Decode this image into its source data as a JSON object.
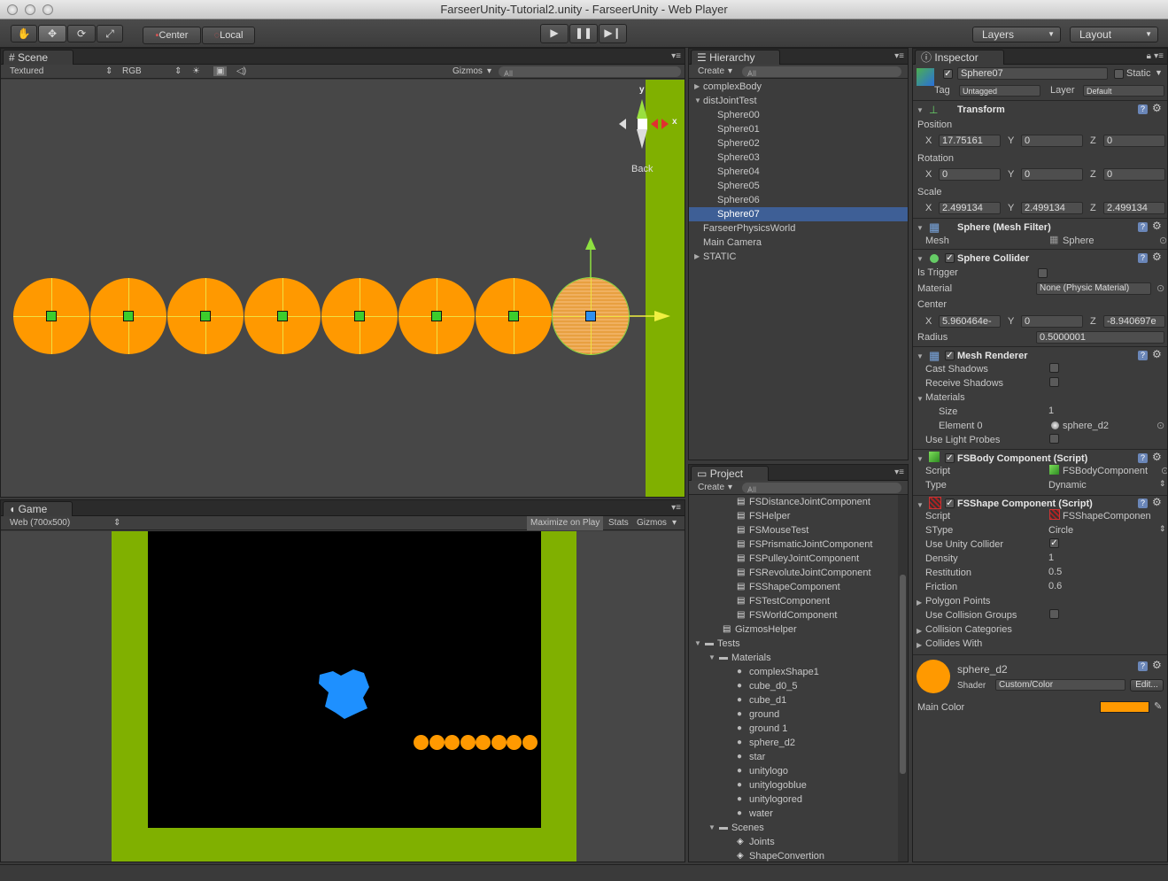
{
  "window": {
    "title": "FarseerUnity-Tutorial2.unity - FarseerUnity - Web Player"
  },
  "toolbar": {
    "pivot_center": "Center",
    "pivot_local": "Local",
    "layers": "Layers",
    "layout": "Layout"
  },
  "scene": {
    "tab": "Scene",
    "render_mode": "Textured",
    "color_mode": "RGB",
    "gizmos": "Gizmos",
    "search_placeholder": "All",
    "gizmo_view_label": "Back",
    "gizmo_axis_y": "y",
    "gizmo_axis_x": "x"
  },
  "game": {
    "tab": "Game",
    "resolution": "Web (700x500)",
    "maximize": "Maximize on Play",
    "stats": "Stats",
    "gizmos": "Gizmos"
  },
  "hierarchy": {
    "tab": "Hierarchy",
    "create": "Create",
    "search_placeholder": "All",
    "items": [
      {
        "label": "complexBody",
        "indent": 0,
        "arrow": "closed",
        "selected": false
      },
      {
        "label": "distJointTest",
        "indent": 0,
        "arrow": "open",
        "selected": false
      },
      {
        "label": "Sphere00",
        "indent": 1,
        "arrow": "",
        "selected": false
      },
      {
        "label": "Sphere01",
        "indent": 1,
        "arrow": "",
        "selected": false
      },
      {
        "label": "Sphere02",
        "indent": 1,
        "arrow": "",
        "selected": false
      },
      {
        "label": "Sphere03",
        "indent": 1,
        "arrow": "",
        "selected": false
      },
      {
        "label": "Sphere04",
        "indent": 1,
        "arrow": "",
        "selected": false
      },
      {
        "label": "Sphere05",
        "indent": 1,
        "arrow": "",
        "selected": false
      },
      {
        "label": "Sphere06",
        "indent": 1,
        "arrow": "",
        "selected": false
      },
      {
        "label": "Sphere07",
        "indent": 1,
        "arrow": "",
        "selected": true
      },
      {
        "label": "FarseerPhysicsWorld",
        "indent": 0,
        "arrow": "",
        "selected": false
      },
      {
        "label": "Main Camera",
        "indent": 0,
        "arrow": "",
        "selected": false
      },
      {
        "label": "STATIC",
        "indent": 0,
        "arrow": "closed",
        "selected": false
      }
    ]
  },
  "project": {
    "tab": "Project",
    "create": "Create",
    "search_placeholder": "All",
    "items": [
      {
        "label": "FSDistanceJointComponent",
        "indent": 3,
        "arrow": "",
        "icon": "script"
      },
      {
        "label": "FSHelper",
        "indent": 3,
        "arrow": "",
        "icon": "script"
      },
      {
        "label": "FSMouseTest",
        "indent": 3,
        "arrow": "",
        "icon": "script"
      },
      {
        "label": "FSPrismaticJointComponent",
        "indent": 3,
        "arrow": "",
        "icon": "script"
      },
      {
        "label": "FSPulleyJointComponent",
        "indent": 3,
        "arrow": "",
        "icon": "script"
      },
      {
        "label": "FSRevoluteJointComponent",
        "indent": 3,
        "arrow": "",
        "icon": "script"
      },
      {
        "label": "FSShapeComponent",
        "indent": 3,
        "arrow": "",
        "icon": "script"
      },
      {
        "label": "FSTestComponent",
        "indent": 3,
        "arrow": "",
        "icon": "script"
      },
      {
        "label": "FSWorldComponent",
        "indent": 3,
        "arrow": "",
        "icon": "script"
      },
      {
        "label": "GizmosHelper",
        "indent": 2,
        "arrow": "",
        "icon": "script"
      },
      {
        "label": "Tests",
        "indent": 0,
        "arrow": "open",
        "icon": "folder"
      },
      {
        "label": "Materials",
        "indent": 1,
        "arrow": "open",
        "icon": "folder"
      },
      {
        "label": "complexShape1",
        "indent": 3,
        "arrow": "",
        "icon": "material"
      },
      {
        "label": "cube_d0_5",
        "indent": 3,
        "arrow": "",
        "icon": "material"
      },
      {
        "label": "cube_d1",
        "indent": 3,
        "arrow": "",
        "icon": "material"
      },
      {
        "label": "ground",
        "indent": 3,
        "arrow": "",
        "icon": "material"
      },
      {
        "label": "ground 1",
        "indent": 3,
        "arrow": "",
        "icon": "material"
      },
      {
        "label": "sphere_d2",
        "indent": 3,
        "arrow": "",
        "icon": "material"
      },
      {
        "label": "star",
        "indent": 3,
        "arrow": "",
        "icon": "material"
      },
      {
        "label": "unitylogo",
        "indent": 3,
        "arrow": "",
        "icon": "material"
      },
      {
        "label": "unitylogoblue",
        "indent": 3,
        "arrow": "",
        "icon": "material"
      },
      {
        "label": "unitylogored",
        "indent": 3,
        "arrow": "",
        "icon": "material"
      },
      {
        "label": "water",
        "indent": 3,
        "arrow": "",
        "icon": "material"
      },
      {
        "label": "Scenes",
        "indent": 1,
        "arrow": "open",
        "icon": "folder"
      },
      {
        "label": "Joints",
        "indent": 3,
        "arrow": "",
        "icon": "scene"
      },
      {
        "label": "ShapeConvertion",
        "indent": 3,
        "arrow": "",
        "icon": "scene"
      }
    ]
  },
  "inspector": {
    "tab": "Inspector",
    "object_name": "Sphere07",
    "static_label": "Static",
    "tag_label": "Tag",
    "tag_value": "Untagged",
    "layer_label": "Layer",
    "layer_value": "Default",
    "transform": {
      "title": "Transform",
      "position_label": "Position",
      "rotation_label": "Rotation",
      "scale_label": "Scale",
      "x": "X",
      "y": "Y",
      "z": "Z",
      "pos_x": "17.75161",
      "pos_y": "0",
      "pos_z": "0",
      "rot_x": "0",
      "rot_y": "0",
      "rot_z": "0",
      "scale_x": "2.499134",
      "scale_y": "2.499134",
      "scale_z": "2.499134"
    },
    "mesh_filter": {
      "title": "Sphere (Mesh Filter)",
      "mesh_label": "Mesh",
      "mesh_value": "Sphere"
    },
    "sphere_collider": {
      "title": "Sphere Collider",
      "is_trigger_label": "Is Trigger",
      "material_label": "Material",
      "material_value": "None (Physic Material)",
      "center_label": "Center",
      "center_x": "5.960464e-",
      "center_y": "0",
      "center_z": "-8.940697e",
      "radius_label": "Radius",
      "radius_value": "0.5000001"
    },
    "mesh_renderer": {
      "title": "Mesh Renderer",
      "cast_shadows": "Cast Shadows",
      "receive_shadows": "Receive Shadows",
      "materials": "Materials",
      "size_label": "Size",
      "size_value": "1",
      "element0_label": "Element 0",
      "element0_value": "sphere_d2",
      "use_light_probes": "Use Light Probes"
    },
    "fsbody": {
      "title": "FSBody Component (Script)",
      "script_label": "Script",
      "script_value": "FSBodyComponent",
      "type_label": "Type",
      "type_value": "Dynamic"
    },
    "fsshape": {
      "title": "FSShape Component (Script)",
      "script_label": "Script",
      "script_value": "FSShapeComponen",
      "stype_label": "SType",
      "stype_value": "Circle",
      "use_unity_collider": "Use Unity Collider",
      "density_label": "Density",
      "density_value": "1",
      "restitution_label": "Restitution",
      "restitution_value": "0.5",
      "friction_label": "Friction",
      "friction_value": "0.6",
      "polygon_points": "Polygon Points",
      "use_collision_groups": "Use Collision Groups",
      "collision_categories": "Collision Categories",
      "collides_with": "Collides With"
    },
    "material": {
      "name": "sphere_d2",
      "shader_label": "Shader",
      "shader_value": "Custom/Color",
      "edit_button": "Edit...",
      "main_color_label": "Main Color",
      "main_color": "#ff9900"
    }
  },
  "colors": {
    "ground": "#80b000",
    "sphere": "#ff9900",
    "blue_shape": "#1e90ff",
    "selection": "#3e5f96"
  }
}
